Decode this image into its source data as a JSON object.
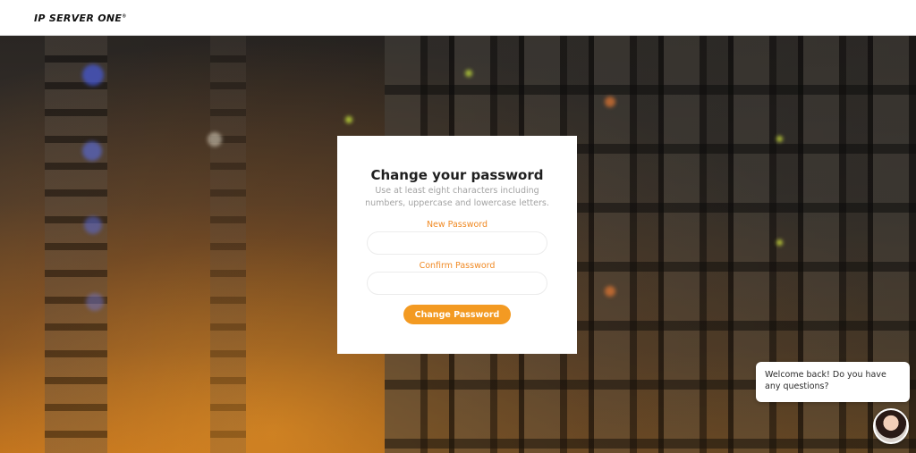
{
  "header": {
    "logo_text": "IP SERVER ONE",
    "logo_mark": "®"
  },
  "card": {
    "title": "Change your password",
    "subtitle": "Use at least eight characters including numbers, uppercase and lowercase letters.",
    "new_password_label": "New Password",
    "new_password_value": "",
    "confirm_password_label": "Confirm Password",
    "confirm_password_value": "",
    "submit_label": "Change Password"
  },
  "chat": {
    "message": "Welcome back! Do you have any questions?",
    "avatar_icon": "agent-avatar-icon"
  },
  "colors": {
    "accent": "#f39a22",
    "label": "#f08a24",
    "subtitle": "#a3a3a3"
  }
}
